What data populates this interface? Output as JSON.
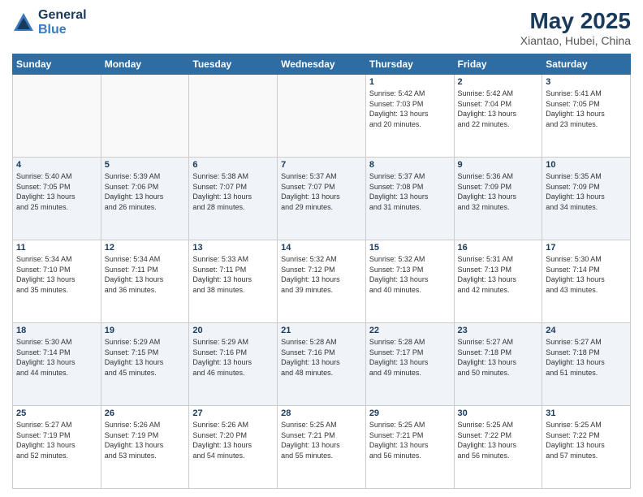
{
  "logo": {
    "general": "General",
    "blue": "Blue"
  },
  "title": "May 2025",
  "location": "Xiantao, Hubei, China",
  "weekdays": [
    "Sunday",
    "Monday",
    "Tuesday",
    "Wednesday",
    "Thursday",
    "Friday",
    "Saturday"
  ],
  "weeks": [
    [
      {
        "day": "",
        "info": "",
        "empty": true
      },
      {
        "day": "",
        "info": "",
        "empty": true
      },
      {
        "day": "",
        "info": "",
        "empty": true
      },
      {
        "day": "",
        "info": "",
        "empty": true
      },
      {
        "day": "1",
        "info": "Sunrise: 5:42 AM\nSunset: 7:03 PM\nDaylight: 13 hours\nand 20 minutes."
      },
      {
        "day": "2",
        "info": "Sunrise: 5:42 AM\nSunset: 7:04 PM\nDaylight: 13 hours\nand 22 minutes."
      },
      {
        "day": "3",
        "info": "Sunrise: 5:41 AM\nSunset: 7:05 PM\nDaylight: 13 hours\nand 23 minutes."
      }
    ],
    [
      {
        "day": "4",
        "info": "Sunrise: 5:40 AM\nSunset: 7:05 PM\nDaylight: 13 hours\nand 25 minutes."
      },
      {
        "day": "5",
        "info": "Sunrise: 5:39 AM\nSunset: 7:06 PM\nDaylight: 13 hours\nand 26 minutes."
      },
      {
        "day": "6",
        "info": "Sunrise: 5:38 AM\nSunset: 7:07 PM\nDaylight: 13 hours\nand 28 minutes."
      },
      {
        "day": "7",
        "info": "Sunrise: 5:37 AM\nSunset: 7:07 PM\nDaylight: 13 hours\nand 29 minutes."
      },
      {
        "day": "8",
        "info": "Sunrise: 5:37 AM\nSunset: 7:08 PM\nDaylight: 13 hours\nand 31 minutes."
      },
      {
        "day": "9",
        "info": "Sunrise: 5:36 AM\nSunset: 7:09 PM\nDaylight: 13 hours\nand 32 minutes."
      },
      {
        "day": "10",
        "info": "Sunrise: 5:35 AM\nSunset: 7:09 PM\nDaylight: 13 hours\nand 34 minutes."
      }
    ],
    [
      {
        "day": "11",
        "info": "Sunrise: 5:34 AM\nSunset: 7:10 PM\nDaylight: 13 hours\nand 35 minutes."
      },
      {
        "day": "12",
        "info": "Sunrise: 5:34 AM\nSunset: 7:11 PM\nDaylight: 13 hours\nand 36 minutes."
      },
      {
        "day": "13",
        "info": "Sunrise: 5:33 AM\nSunset: 7:11 PM\nDaylight: 13 hours\nand 38 minutes."
      },
      {
        "day": "14",
        "info": "Sunrise: 5:32 AM\nSunset: 7:12 PM\nDaylight: 13 hours\nand 39 minutes."
      },
      {
        "day": "15",
        "info": "Sunrise: 5:32 AM\nSunset: 7:13 PM\nDaylight: 13 hours\nand 40 minutes."
      },
      {
        "day": "16",
        "info": "Sunrise: 5:31 AM\nSunset: 7:13 PM\nDaylight: 13 hours\nand 42 minutes."
      },
      {
        "day": "17",
        "info": "Sunrise: 5:30 AM\nSunset: 7:14 PM\nDaylight: 13 hours\nand 43 minutes."
      }
    ],
    [
      {
        "day": "18",
        "info": "Sunrise: 5:30 AM\nSunset: 7:14 PM\nDaylight: 13 hours\nand 44 minutes."
      },
      {
        "day": "19",
        "info": "Sunrise: 5:29 AM\nSunset: 7:15 PM\nDaylight: 13 hours\nand 45 minutes."
      },
      {
        "day": "20",
        "info": "Sunrise: 5:29 AM\nSunset: 7:16 PM\nDaylight: 13 hours\nand 46 minutes."
      },
      {
        "day": "21",
        "info": "Sunrise: 5:28 AM\nSunset: 7:16 PM\nDaylight: 13 hours\nand 48 minutes."
      },
      {
        "day": "22",
        "info": "Sunrise: 5:28 AM\nSunset: 7:17 PM\nDaylight: 13 hours\nand 49 minutes."
      },
      {
        "day": "23",
        "info": "Sunrise: 5:27 AM\nSunset: 7:18 PM\nDaylight: 13 hours\nand 50 minutes."
      },
      {
        "day": "24",
        "info": "Sunrise: 5:27 AM\nSunset: 7:18 PM\nDaylight: 13 hours\nand 51 minutes."
      }
    ],
    [
      {
        "day": "25",
        "info": "Sunrise: 5:27 AM\nSunset: 7:19 PM\nDaylight: 13 hours\nand 52 minutes."
      },
      {
        "day": "26",
        "info": "Sunrise: 5:26 AM\nSunset: 7:19 PM\nDaylight: 13 hours\nand 53 minutes."
      },
      {
        "day": "27",
        "info": "Sunrise: 5:26 AM\nSunset: 7:20 PM\nDaylight: 13 hours\nand 54 minutes."
      },
      {
        "day": "28",
        "info": "Sunrise: 5:25 AM\nSunset: 7:21 PM\nDaylight: 13 hours\nand 55 minutes."
      },
      {
        "day": "29",
        "info": "Sunrise: 5:25 AM\nSunset: 7:21 PM\nDaylight: 13 hours\nand 56 minutes."
      },
      {
        "day": "30",
        "info": "Sunrise: 5:25 AM\nSunset: 7:22 PM\nDaylight: 13 hours\nand 56 minutes."
      },
      {
        "day": "31",
        "info": "Sunrise: 5:25 AM\nSunset: 7:22 PM\nDaylight: 13 hours\nand 57 minutes."
      }
    ]
  ]
}
